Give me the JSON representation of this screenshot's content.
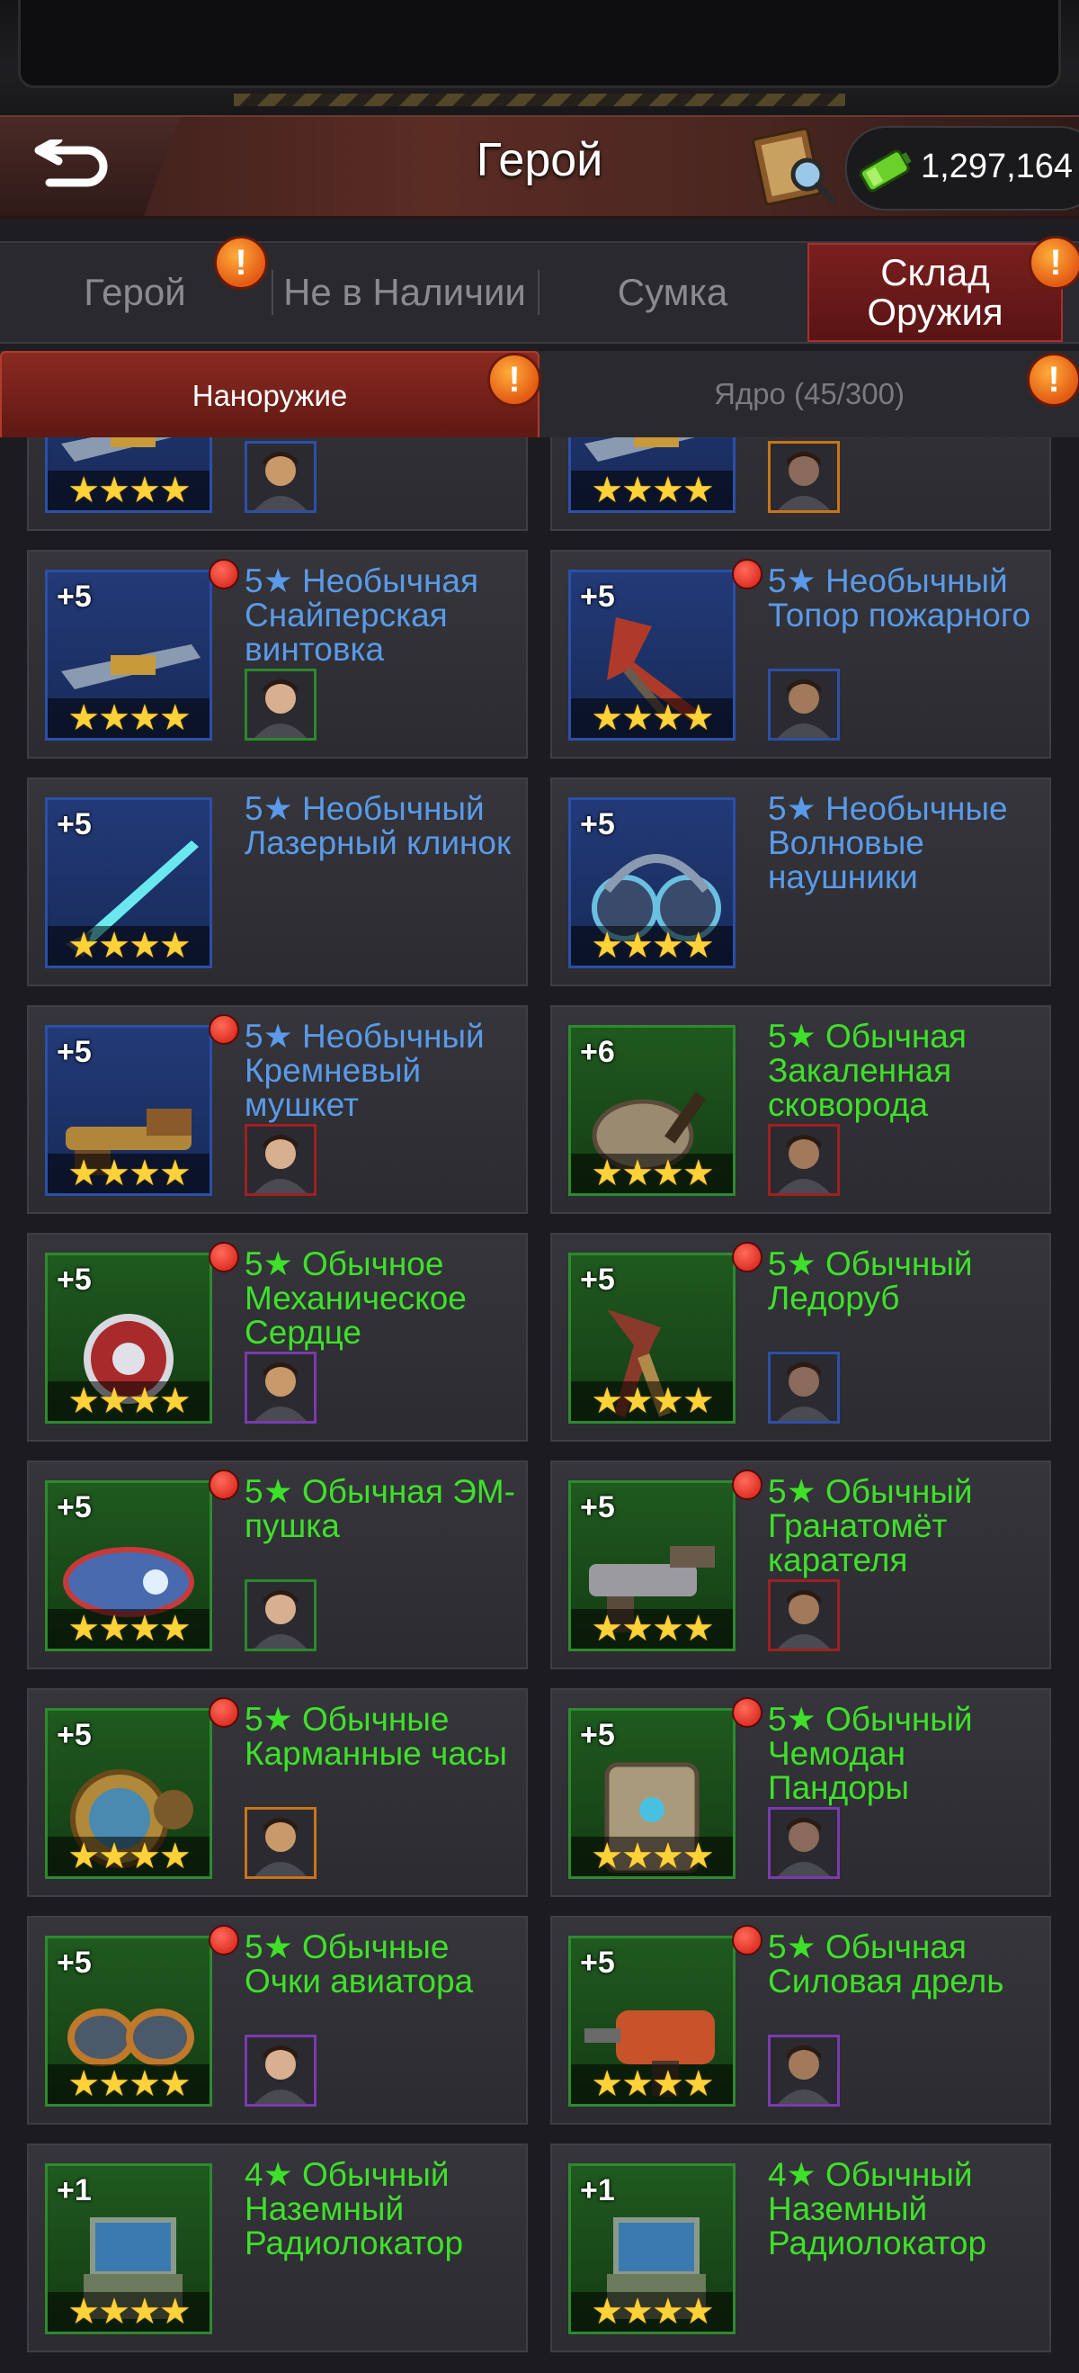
{
  "header": {
    "title": "Герой",
    "currency_value": "1,297,164",
    "back_icon": "back-arrow-icon",
    "codex_icon": "book-magnifier-icon",
    "currency_icon": "battery-icon"
  },
  "tabs": [
    {
      "label": "Герой",
      "active": false,
      "alert": true
    },
    {
      "label": "Не в Наличии",
      "active": false,
      "alert": false
    },
    {
      "label": "Сумка",
      "active": false,
      "alert": false
    },
    {
      "label": "Склад Оружия",
      "active": true,
      "alert": true
    }
  ],
  "subtabs": [
    {
      "label": "Наноружие",
      "active": true,
      "alert": true
    },
    {
      "label": "Ядро (45/300)",
      "active": false,
      "alert": true
    }
  ],
  "alert_glyph": "!",
  "stars_4": "★★★★",
  "items": [
    {
      "title": "",
      "plus": "",
      "quality": "blue",
      "dot": false,
      "avatar": "blue",
      "partial": true
    },
    {
      "title": "",
      "plus": "",
      "quality": "blue",
      "dot": false,
      "avatar": "orange",
      "partial": true
    },
    {
      "title": "5★ Необычная Снайперская винтовка",
      "plus": "+5",
      "quality": "blue",
      "dot": true,
      "avatar": "green"
    },
    {
      "title": "5★ Необычный Топор пожарного",
      "plus": "+5",
      "quality": "blue",
      "dot": true,
      "avatar": "blue"
    },
    {
      "title": "5★ Необычный Лазерный клинок",
      "plus": "+5",
      "quality": "blue",
      "dot": false,
      "avatar": ""
    },
    {
      "title": "5★ Необычные Волновые наушники",
      "plus": "+5",
      "quality": "blue",
      "dot": false,
      "avatar": ""
    },
    {
      "title": "5★ Необычный Кремневый мушкет",
      "plus": "+5",
      "quality": "blue",
      "dot": true,
      "avatar": "red"
    },
    {
      "title": "5★ Обычная Закаленная сковорода",
      "plus": "+6",
      "quality": "green",
      "dot": false,
      "avatar": "red"
    },
    {
      "title": "5★ Обычное Механическое Сердце",
      "plus": "+5",
      "quality": "green",
      "dot": true,
      "avatar": "purple"
    },
    {
      "title": "5★ Обычный Ледоруб",
      "plus": "+5",
      "quality": "green",
      "dot": true,
      "avatar": "blue"
    },
    {
      "title": "5★ Обычная ЭМ-пушка",
      "plus": "+5",
      "quality": "green",
      "dot": true,
      "avatar": "green"
    },
    {
      "title": "5★ Обычный Гранатомёт карателя",
      "plus": "+5",
      "quality": "green",
      "dot": true,
      "avatar": "red"
    },
    {
      "title": "5★ Обычные Карманные часы",
      "plus": "+5",
      "quality": "green",
      "dot": true,
      "avatar": "orange"
    },
    {
      "title": "5★ Обычный Чемодан Пандоры",
      "plus": "+5",
      "quality": "green",
      "dot": true,
      "avatar": "purple"
    },
    {
      "title": "5★ Обычные Очки авиатора",
      "plus": "+5",
      "quality": "green",
      "dot": true,
      "avatar": "purple"
    },
    {
      "title": "5★ Обычная Силовая дрель",
      "plus": "+5",
      "quality": "green",
      "dot": true,
      "avatar": "purple"
    },
    {
      "title": "4★ Обычный Наземный Радиолокатор",
      "plus": "+1",
      "quality": "green",
      "dot": false,
      "avatar": ""
    },
    {
      "title": "4★ Обычный Наземный Радиолокатор",
      "plus": "+1",
      "quality": "green",
      "dot": false,
      "avatar": ""
    }
  ]
}
